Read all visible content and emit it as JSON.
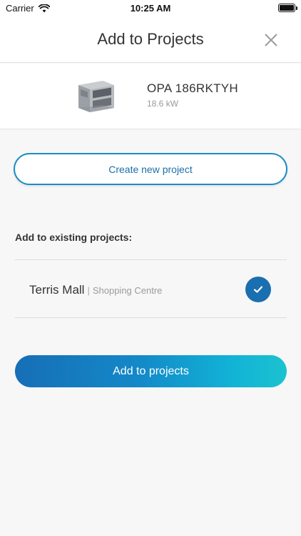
{
  "status_bar": {
    "carrier": "Carrier",
    "time": "10:25 AM"
  },
  "header": {
    "title": "Add to Projects"
  },
  "product": {
    "name": "OPA 186RKTYH",
    "power": "18.6 kW"
  },
  "create_button": {
    "label": "Create new project"
  },
  "existing_section": {
    "label": "Add to existing projects:",
    "projects": [
      {
        "name": "Terris Mall",
        "separator": "|",
        "type": "Shopping Centre",
        "selected": true
      }
    ]
  },
  "add_button": {
    "label": "Add to projects"
  },
  "colors": {
    "accent": "#1a6fb0",
    "gradient_start": "#166fb6",
    "gradient_end": "#1bc2cf"
  },
  "icons": {
    "wifi": "wifi-icon",
    "battery": "battery-icon",
    "close": "close-icon",
    "check": "check-icon",
    "product": "ac-unit-image"
  }
}
